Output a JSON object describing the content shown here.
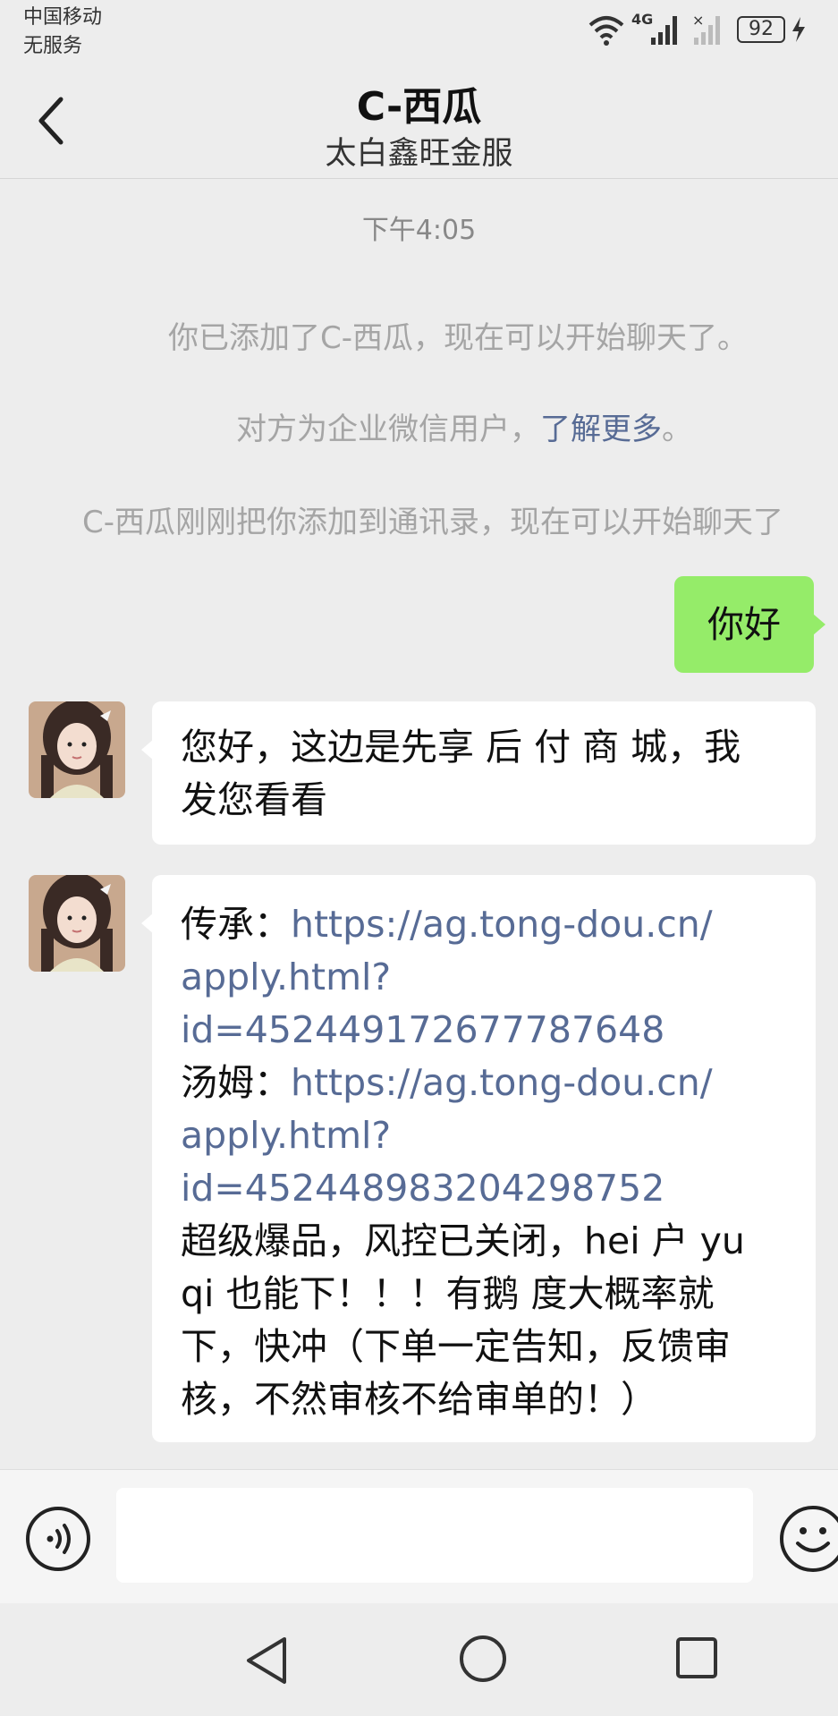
{
  "status_bar": {
    "carrier_line1": "中国移动",
    "carrier_line2": "无服务",
    "network": "4G",
    "battery": "92"
  },
  "header": {
    "title": "C-西瓜",
    "subtitle": "太白鑫旺金服"
  },
  "chat": {
    "timestamp": "下午4:05",
    "system_added": "你已添加了C-西瓜，现在可以开始聊天了。",
    "system_enterprise_prefix": "对方为企业微信用户，",
    "system_enterprise_link": "了解更多",
    "system_enterprise_suffix": "。",
    "system_contact": "C-西瓜刚刚把你添加到通讯录，现在可以开始聊天了",
    "sent_message": "你好",
    "msg1_line1": "您好，这边是先享 后 付 商 城，我",
    "msg1_line2": "发您看看",
    "msg2": {
      "label1": "传承：",
      "link1_part1": "https://ag.tong-dou.cn/",
      "link1_part2": "apply.html?",
      "link1_part3": "id=452449172677787648",
      "label2": "汤姆：",
      "link2_part1": "https://ag.tong-dou.cn/",
      "link2_part2": "apply.html?",
      "link2_part3": "id=452448983204298752",
      "text_line1": "超级爆品，风控已关闭，hei 户 yu",
      "text_line2": "qi 也能下！！！有鹅 度大概率就",
      "text_line3": "下，快冲（下单一定告知，反馈审",
      "text_line4": "核，不然审核不给审单的！）"
    }
  },
  "input_bar": {
    "voice_icon": "voice-icon",
    "emoji_icon": "emoji-icon",
    "text_value": ""
  },
  "nav_bar": {
    "back": "triangle-back-icon",
    "home": "circle-home-icon",
    "recent": "square-recent-icon"
  },
  "colors": {
    "background": "#ededed",
    "sent_bubble": "#95ec69",
    "link": "#576b95",
    "system_text": "#a5a5a5"
  }
}
